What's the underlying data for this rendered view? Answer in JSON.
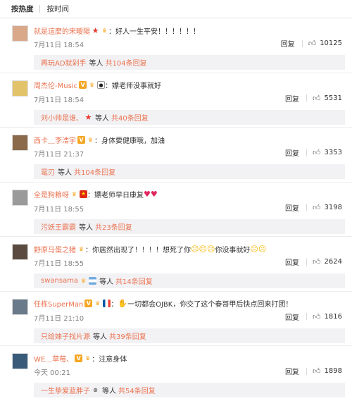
{
  "sort": {
    "hot": "按热度",
    "time": "按时间"
  },
  "comments": [
    {
      "user": "就是這麼的宋曖陽",
      "text": "：好人一生平安！！！！！！",
      "time": "7月11日 18:54",
      "reply": "回复",
      "likes": "10125",
      "sub_user": "再玩AD就剁手",
      "sub_others": "等人",
      "sub_count": "共104条回复",
      "avatar_color": "#d9a88a"
    },
    {
      "user": "周杰伦-Music",
      "text": "：嫖老师没事就好",
      "time": "7月11日 18:54",
      "reply": "回复",
      "likes": "5531",
      "sub_user": "刘小帅是谁、",
      "sub_others": "等人",
      "sub_count": "共40条回复",
      "avatar_color": "#e3c36a"
    },
    {
      "user": "西卡＿李浩宇",
      "text": "：身体要健康哦，加油",
      "time": "7月11日 21:37",
      "reply": "回复",
      "likes": "3353",
      "sub_user": "鼋刃",
      "sub_others": "等人",
      "sub_count": "共104条回复",
      "avatar_color": "#8a6a4a"
    },
    {
      "user": "全是狗粮呀",
      "text": "：嫖老师早日康复",
      "time": "7月11日 18:55",
      "reply": "回复",
      "likes": "3198",
      "sub_user": "污妖王霸霸",
      "sub_others": "等人",
      "sub_count": "共23条回复",
      "avatar_color": "#9a9a9a"
    },
    {
      "user": "野原马蛋之猪",
      "text": "：你居然出现了！！！！想死了你",
      "text2": "你没事就好",
      "time": "7月11日 18:55",
      "reply": "回复",
      "likes": "2624",
      "sub_user": "swansama",
      "sub_others": "等人",
      "sub_count": "共14条回复",
      "avatar_color": "#5a4a40"
    },
    {
      "user": "任栋SuperMan",
      "text": "一切都会OJBK，你交了这个春哥甲后快点回来打团！",
      "time": "7月11日 21:10",
      "reply": "回复",
      "likes": "1816",
      "sub_user": "只给妹子找片源",
      "sub_others": "等人",
      "sub_count": "共39条回复",
      "avatar_color": "#6a7a8a"
    },
    {
      "user": "WE＿草莓、",
      "text": "：注意身体",
      "time": "今天 00:21",
      "reply": "回复",
      "likes": "1898",
      "sub_user": "一生挚爱蓝胖子",
      "sub_others": "等人",
      "sub_count": "共54条回复",
      "avatar_color": "#3a5a7a"
    }
  ],
  "colors": {
    "username": "#eb7350",
    "time": "#808080",
    "sub_bg": "#f2f2f5"
  },
  "icons": [
    "like-thumb-icon",
    "v-verified-icon",
    "crown-badge-icon",
    "red-star-icon",
    "china-flag-icon",
    "panda-icon",
    "argentina-flag-icon",
    "france-flag-icon",
    "heart-emoji-icon",
    "crying-emoji-icon",
    "handshake-emoji-icon"
  ]
}
